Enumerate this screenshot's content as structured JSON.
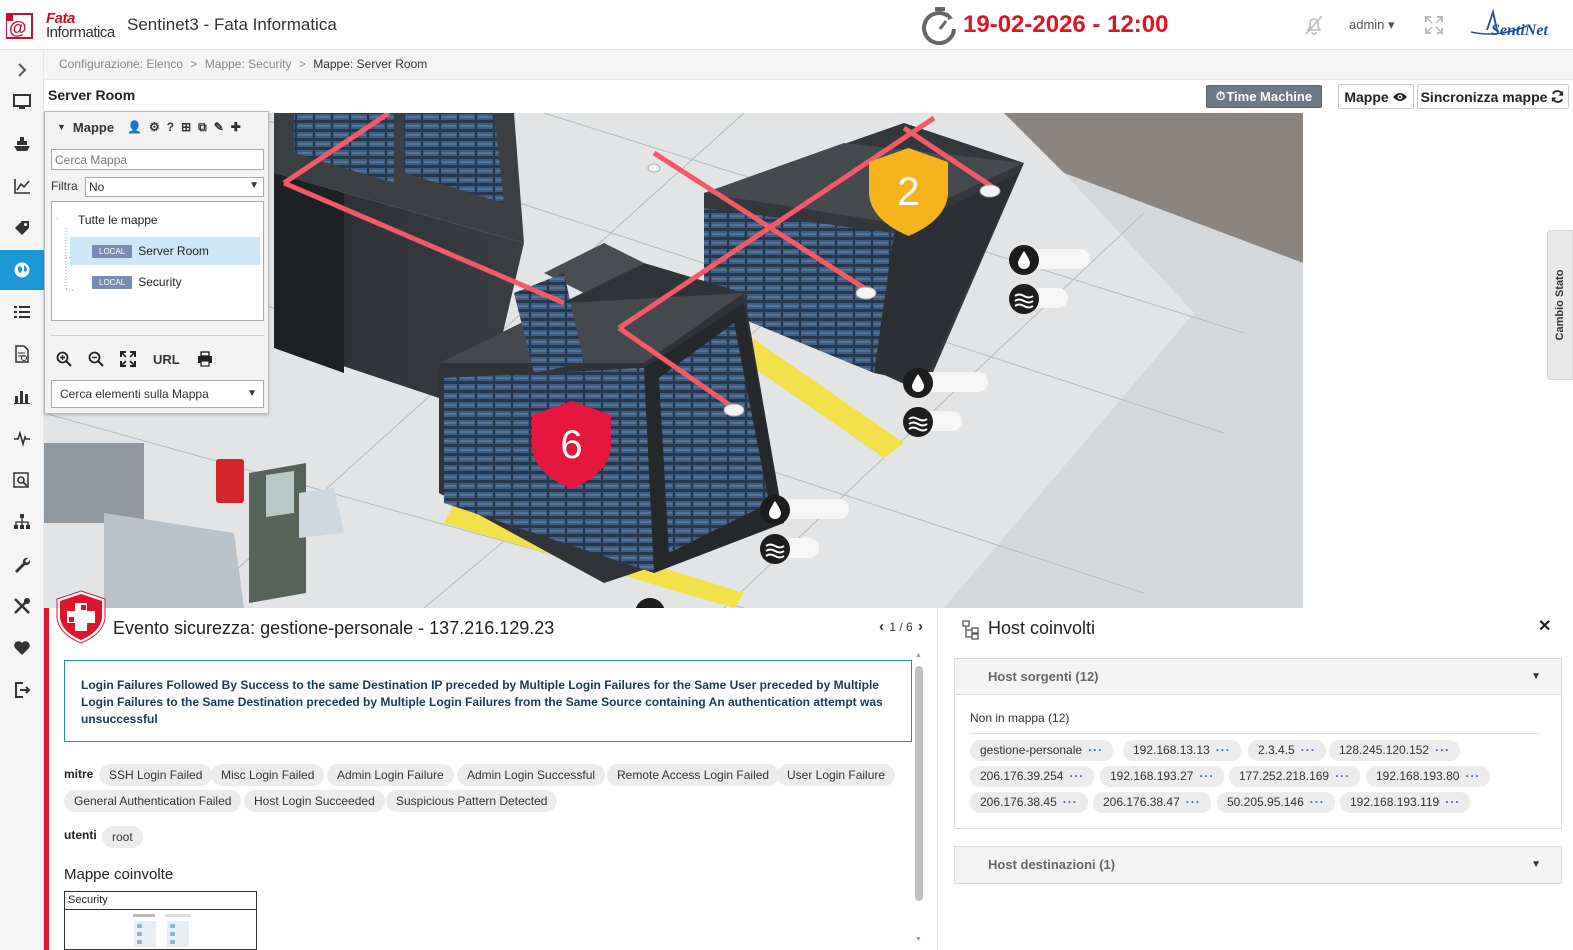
{
  "header": {
    "logo_line1": "Fata",
    "logo_line2": "Informatica",
    "app_title": "Sentinet3 - Fata Informatica",
    "datetime": "19-02-2026 - 12:00",
    "user_label": "admin",
    "datetime_color": "#e4141e"
  },
  "sidebar": {
    "items": [
      {
        "icon": "chevron-right-icon"
      },
      {
        "icon": "monitor-icon"
      },
      {
        "icon": "ship-icon"
      },
      {
        "icon": "line-chart-icon"
      },
      {
        "icon": "tags-icon"
      },
      {
        "icon": "globe-icon",
        "active": true
      },
      {
        "icon": "list-icon"
      },
      {
        "icon": "report-icon"
      },
      {
        "icon": "bar-chart-icon"
      },
      {
        "icon": "pulse-icon"
      },
      {
        "icon": "search-doc-icon"
      },
      {
        "icon": "network-icon"
      },
      {
        "icon": "wrench-icon"
      },
      {
        "icon": "tools-icon"
      },
      {
        "icon": "heart-icon"
      },
      {
        "icon": "logout-icon"
      }
    ],
    "active_color": "#1c98d6"
  },
  "breadcrumb": {
    "items": [
      "Configurazione: Elenco",
      "Mappe: Security",
      "Mappe: Server Room"
    ],
    "separator": ">"
  },
  "map": {
    "title": "Server Room",
    "time_machine_label": "Time Machine",
    "mappe_label": "Mappe",
    "sync_label": "Sincronizza mappe",
    "cambio_stato_label": "Cambio Stato",
    "alarm_badges": [
      {
        "value": "2",
        "color": "#f5b31e"
      },
      {
        "value": "6",
        "color": "#e6163f"
      }
    ]
  },
  "maps_panel": {
    "header_label": "Mappe",
    "search_placeholder": "Cerca Mappa",
    "filter_label": "Filtra",
    "filter_value": "No",
    "tree_root": "Tutte le mappe",
    "tree_items": [
      {
        "badge": "LOCAL",
        "label": "Server Room",
        "selected": true
      },
      {
        "badge": "LOCAL",
        "label": "Security",
        "selected": false
      }
    ],
    "url_label": "URL",
    "element_search_value": "Cerca elementi sulla Mappa"
  },
  "event": {
    "title": "Evento sicurezza: gestione-personale - 137.216.129.23",
    "pager": "1 / 6",
    "description": "Login Failures Followed By Success to the same Destination IP preceded by Multiple Login Failures for the Same User preceded by Multiple Login Failures to the Same Destination preceded by Multiple Login Failures from the Same Source containing An authentication attempt was unsuccessful",
    "mitre_label": "mitre",
    "mitre_tags": [
      "SSH Login Failed",
      "Misc Login Failed",
      "Admin Login Failure",
      "Admin Login Successful",
      "Remote Access Login Failed",
      "User Login Failure",
      "General Authentication Failed",
      "Host Login Succeeded",
      "Suspicious Pattern Detected"
    ],
    "utenti_label": "utenti",
    "utenti_tags": [
      "root"
    ],
    "maps_involved_label": "Mappe coinvolte",
    "maps_involved": [
      "Security"
    ],
    "accent_color": "#e2132b"
  },
  "hosts": {
    "title": "Host coinvolti",
    "sources_label": "Host sorgenti (12)",
    "not_in_map_label": "Non in mappa (12)",
    "sources": [
      "gestione-personale",
      "192.168.13.13",
      "2.3.4.5",
      "128.245.120.152",
      "206.176.39.254",
      "192.168.193.27",
      "177.252.218.169",
      "192.168.193.80",
      "206.176.38.45",
      "206.176.38.47",
      "50.205.95.146",
      "192.168.193.119"
    ],
    "more_label": "···",
    "destinations_label": "Host destinazioni (1)"
  }
}
